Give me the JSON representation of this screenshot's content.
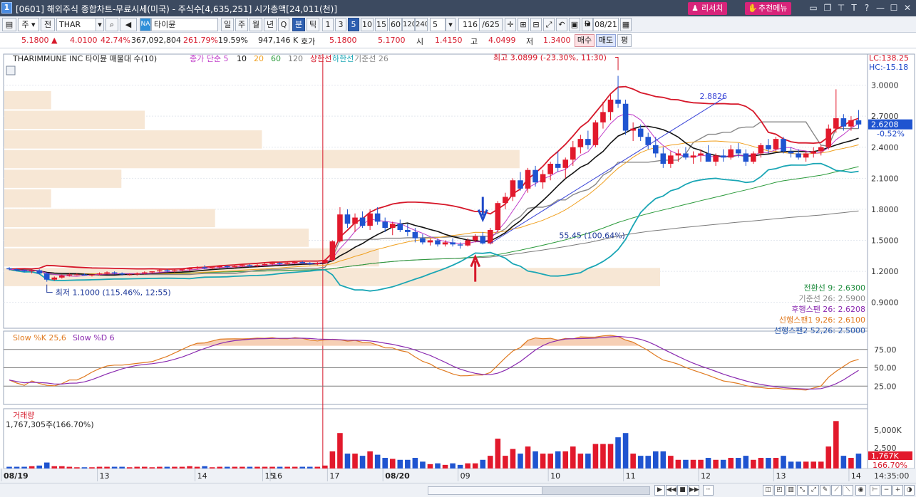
{
  "title": {
    "window_number": "1",
    "text": "[0601] 해외주식 종합차트-무료시세(미국) - 주식수[4,635,251] 시가총액[24,011(천)]",
    "research_label": "리서치",
    "menu_label": "추천메뉴"
  },
  "toolbar": {
    "mode": "주",
    "scope": "전",
    "symbol": "THAR",
    "exchange_badge": "NA",
    "name": "타이뮨",
    "periods": [
      "일",
      "주",
      "월",
      "년",
      "Q",
      "분",
      "틱"
    ],
    "minute_options": [
      "1",
      "3",
      "5",
      "10",
      "15",
      "60",
      "120",
      "240"
    ],
    "interval_value": "5",
    "count": "116",
    "count_total": "/625",
    "date_checkbox_label": "D",
    "date": "08/21"
  },
  "quote": {
    "price": "5.1800",
    "change": "4.0100",
    "change_pct": "42.74%",
    "volume": "367,092,804",
    "volume_pct": "261.79%",
    "turnover": "19.59%",
    "amount": "947,146 K",
    "ask_label": "호가",
    "ask": "5.1800",
    "bid": "5.1700",
    "open_label": "시",
    "open": "1.4150",
    "high_label": "고",
    "high": "4.0499",
    "low_label": "저",
    "low": "1.3400",
    "buy_label": "매수",
    "sell_label": "매도",
    "eval_label": "평"
  },
  "chart_data": [
    {
      "type": "candlestick",
      "panel": "price",
      "title": "THARIMMUNE INC  타이뮨 매물대 수(10)",
      "legend": [
        {
          "name": "종가 단순 5",
          "color": "#c03cc8"
        },
        {
          "name": "10",
          "color": "#111111"
        },
        {
          "name": "20",
          "color": "#f0a020"
        },
        {
          "name": "60",
          "color": "#2a9a3a"
        },
        {
          "name": "120",
          "color": "#7a7a7a"
        },
        {
          "name": "상한선",
          "color": "#d6182a"
        },
        {
          "name": "하한선",
          "color": "#1aa6b5"
        },
        {
          "name": "기준선 26",
          "color": "#888888"
        }
      ],
      "ylim": [
        0.65,
        3.3
      ],
      "y_ticks": [
        "3.0000",
        "2.7000",
        "2.4000",
        "2.1000",
        "1.8000",
        "1.5000",
        "1.2000",
        "0.9000"
      ],
      "x_ticks": [
        "08/19",
        "13",
        "14",
        "15",
        "16",
        "17",
        "08/20",
        "09",
        "10",
        "11",
        "12",
        "13",
        "14",
        "14:35:00"
      ],
      "lc": "LC:138.25",
      "hc": "HC:-15.18",
      "current_price": "2.6208",
      "current_change": "-0.52%",
      "annotations": {
        "high": "최고 3.0899 (-23.30%, 11:30)",
        "low": "최저 1.1000 (115.46%, 12:55)",
        "gain": "55.45 (100.64%)",
        "trend_end": "2.8826"
      },
      "ichimoku": [
        {
          "label": "전환선 9: 2.6300",
          "color": "#1a8a3a"
        },
        {
          "label": "기준선 26: 2.5900",
          "color": "#888888"
        },
        {
          "label": "후행스팬 26: 2.6208",
          "color": "#8a2ab0"
        },
        {
          "label": "선행스팬1 9,26: 2.6100",
          "color": "#e07a20"
        },
        {
          "label": "선행스팬2 52,26: 2.5000",
          "color": "#2a5ab0"
        }
      ],
      "candles": [
        [
          1.23,
          1.24,
          1.21,
          1.22
        ],
        [
          1.22,
          1.23,
          1.2,
          1.21
        ],
        [
          1.21,
          1.22,
          1.19,
          1.2
        ],
        [
          1.2,
          1.22,
          1.18,
          1.21
        ],
        [
          1.21,
          1.22,
          1.17,
          1.18
        ],
        [
          1.18,
          1.19,
          1.1,
          1.12
        ],
        [
          1.12,
          1.15,
          1.11,
          1.14
        ],
        [
          1.14,
          1.17,
          1.13,
          1.16
        ],
        [
          1.16,
          1.18,
          1.15,
          1.17
        ],
        [
          1.17,
          1.18,
          1.16,
          1.17
        ],
        [
          1.17,
          1.18,
          1.16,
          1.16
        ],
        [
          1.16,
          1.17,
          1.15,
          1.17
        ],
        [
          1.17,
          1.19,
          1.16,
          1.18
        ],
        [
          1.18,
          1.2,
          1.17,
          1.19
        ],
        [
          1.19,
          1.2,
          1.17,
          1.18
        ],
        [
          1.18,
          1.19,
          1.16,
          1.17
        ],
        [
          1.17,
          1.18,
          1.16,
          1.17
        ],
        [
          1.17,
          1.19,
          1.16,
          1.18
        ],
        [
          1.18,
          1.2,
          1.17,
          1.19
        ],
        [
          1.19,
          1.2,
          1.18,
          1.2
        ],
        [
          1.2,
          1.22,
          1.19,
          1.21
        ],
        [
          1.21,
          1.22,
          1.19,
          1.2
        ],
        [
          1.2,
          1.22,
          1.19,
          1.21
        ],
        [
          1.21,
          1.23,
          1.2,
          1.22
        ],
        [
          1.22,
          1.24,
          1.2,
          1.23
        ],
        [
          1.23,
          1.25,
          1.22,
          1.24
        ],
        [
          1.24,
          1.26,
          1.22,
          1.23
        ],
        [
          1.23,
          1.24,
          1.22,
          1.24
        ],
        [
          1.24,
          1.26,
          1.23,
          1.25
        ],
        [
          1.25,
          1.26,
          1.23,
          1.24
        ],
        [
          1.24,
          1.26,
          1.23,
          1.25
        ],
        [
          1.25,
          1.27,
          1.24,
          1.26
        ],
        [
          1.26,
          1.27,
          1.24,
          1.25
        ],
        [
          1.25,
          1.27,
          1.24,
          1.26
        ],
        [
          1.26,
          1.28,
          1.25,
          1.27
        ],
        [
          1.27,
          1.29,
          1.26,
          1.28
        ],
        [
          1.28,
          1.29,
          1.26,
          1.27
        ],
        [
          1.27,
          1.29,
          1.26,
          1.28
        ],
        [
          1.28,
          1.3,
          1.27,
          1.29
        ],
        [
          1.29,
          1.3,
          1.27,
          1.28
        ],
        [
          1.28,
          1.29,
          1.26,
          1.27
        ],
        [
          1.27,
          1.29,
          1.26,
          1.28
        ],
        [
          1.28,
          1.32,
          1.27,
          1.31
        ],
        [
          1.31,
          1.5,
          1.3,
          1.49
        ],
        [
          1.49,
          1.82,
          1.48,
          1.75
        ],
        [
          1.75,
          1.8,
          1.62,
          1.66
        ],
        [
          1.66,
          1.76,
          1.58,
          1.72
        ],
        [
          1.72,
          1.78,
          1.62,
          1.64
        ],
        [
          1.64,
          1.8,
          1.6,
          1.76
        ],
        [
          1.76,
          1.82,
          1.65,
          1.68
        ],
        [
          1.68,
          1.72,
          1.58,
          1.62
        ],
        [
          1.62,
          1.68,
          1.55,
          1.66
        ],
        [
          1.66,
          1.7,
          1.58,
          1.6
        ],
        [
          1.6,
          1.66,
          1.54,
          1.58
        ],
        [
          1.58,
          1.62,
          1.48,
          1.52
        ],
        [
          1.52,
          1.56,
          1.46,
          1.48
        ],
        [
          1.48,
          1.52,
          1.45,
          1.5
        ],
        [
          1.5,
          1.52,
          1.44,
          1.46
        ],
        [
          1.46,
          1.5,
          1.44,
          1.48
        ],
        [
          1.48,
          1.52,
          1.44,
          1.46
        ],
        [
          1.46,
          1.48,
          1.42,
          1.45
        ],
        [
          1.45,
          1.52,
          1.44,
          1.5
        ],
        [
          1.5,
          1.56,
          1.48,
          1.54
        ],
        [
          1.54,
          1.58,
          1.46,
          1.47
        ],
        [
          1.47,
          1.62,
          1.46,
          1.6
        ],
        [
          1.6,
          1.88,
          1.58,
          1.86
        ],
        [
          1.86,
          1.96,
          1.8,
          1.92
        ],
        [
          1.92,
          2.1,
          1.88,
          2.08
        ],
        [
          2.08,
          2.16,
          1.98,
          2.0
        ],
        [
          2.0,
          2.2,
          1.96,
          2.18
        ],
        [
          2.18,
          2.22,
          2.02,
          2.06
        ],
        [
          2.06,
          2.18,
          2.0,
          2.14
        ],
        [
          2.14,
          2.26,
          2.08,
          2.24
        ],
        [
          2.24,
          2.36,
          2.16,
          2.2
        ],
        [
          2.2,
          2.3,
          2.1,
          2.28
        ],
        [
          2.28,
          2.46,
          2.22,
          2.4
        ],
        [
          2.4,
          2.52,
          2.34,
          2.48
        ],
        [
          2.48,
          2.56,
          2.38,
          2.42
        ],
        [
          2.42,
          2.66,
          2.4,
          2.64
        ],
        [
          2.64,
          2.84,
          2.58,
          2.74
        ],
        [
          2.74,
          2.92,
          2.66,
          2.86
        ],
        [
          2.86,
          3.09,
          2.78,
          2.82
        ],
        [
          2.82,
          2.86,
          2.52,
          2.56
        ],
        [
          2.56,
          2.64,
          2.46,
          2.58
        ],
        [
          2.58,
          2.62,
          2.46,
          2.5
        ],
        [
          2.5,
          2.54,
          2.38,
          2.42
        ],
        [
          2.42,
          2.5,
          2.3,
          2.34
        ],
        [
          2.34,
          2.4,
          2.2,
          2.24
        ],
        [
          2.24,
          2.36,
          2.2,
          2.32
        ],
        [
          2.32,
          2.38,
          2.26,
          2.34
        ],
        [
          2.34,
          2.4,
          2.28,
          2.3
        ],
        [
          2.3,
          2.36,
          2.24,
          2.32
        ],
        [
          2.32,
          2.38,
          2.26,
          2.34
        ],
        [
          2.34,
          2.42,
          2.28,
          2.26
        ],
        [
          2.26,
          2.34,
          2.22,
          2.32
        ],
        [
          2.32,
          2.38,
          2.26,
          2.3
        ],
        [
          2.3,
          2.42,
          2.28,
          2.38
        ],
        [
          2.38,
          2.44,
          2.3,
          2.34
        ],
        [
          2.34,
          2.38,
          2.22,
          2.26
        ],
        [
          2.26,
          2.36,
          2.24,
          2.34
        ],
        [
          2.34,
          2.44,
          2.3,
          2.42
        ],
        [
          2.42,
          2.48,
          2.34,
          2.38
        ],
        [
          2.38,
          2.5,
          2.36,
          2.48
        ],
        [
          2.48,
          2.5,
          2.34,
          2.36
        ],
        [
          2.36,
          2.4,
          2.3,
          2.34
        ],
        [
          2.34,
          2.38,
          2.28,
          2.3
        ],
        [
          2.3,
          2.36,
          2.26,
          2.34
        ],
        [
          2.34,
          2.4,
          2.3,
          2.36
        ],
        [
          2.36,
          2.42,
          2.32,
          2.4
        ],
        [
          2.4,
          2.62,
          2.38,
          2.58
        ],
        [
          2.58,
          2.96,
          2.54,
          2.68
        ],
        [
          2.68,
          2.72,
          2.56,
          2.6
        ],
        [
          2.6,
          2.7,
          2.56,
          2.66
        ],
        [
          2.66,
          2.76,
          2.58,
          2.62
        ]
      ]
    },
    {
      "type": "line",
      "panel": "stochastic",
      "title": "Slow %K 25,6  Slow %D 6",
      "series": [
        {
          "name": "Slow %K 25,6",
          "color": "#e07a20"
        },
        {
          "name": "Slow %D 6",
          "color": "#8a2ab0"
        }
      ],
      "ylim": [
        0,
        100
      ],
      "y_ticks": [
        "75.00",
        "50.00",
        "25.00"
      ]
    },
    {
      "type": "bar",
      "panel": "volume",
      "title": "거래량",
      "value_label": "1,767,305주(166.70%)",
      "y_ticks": [
        "5,000K",
        "2,500"
      ],
      "last_value": "1,767K",
      "last_pct": "166.70%"
    }
  ]
}
